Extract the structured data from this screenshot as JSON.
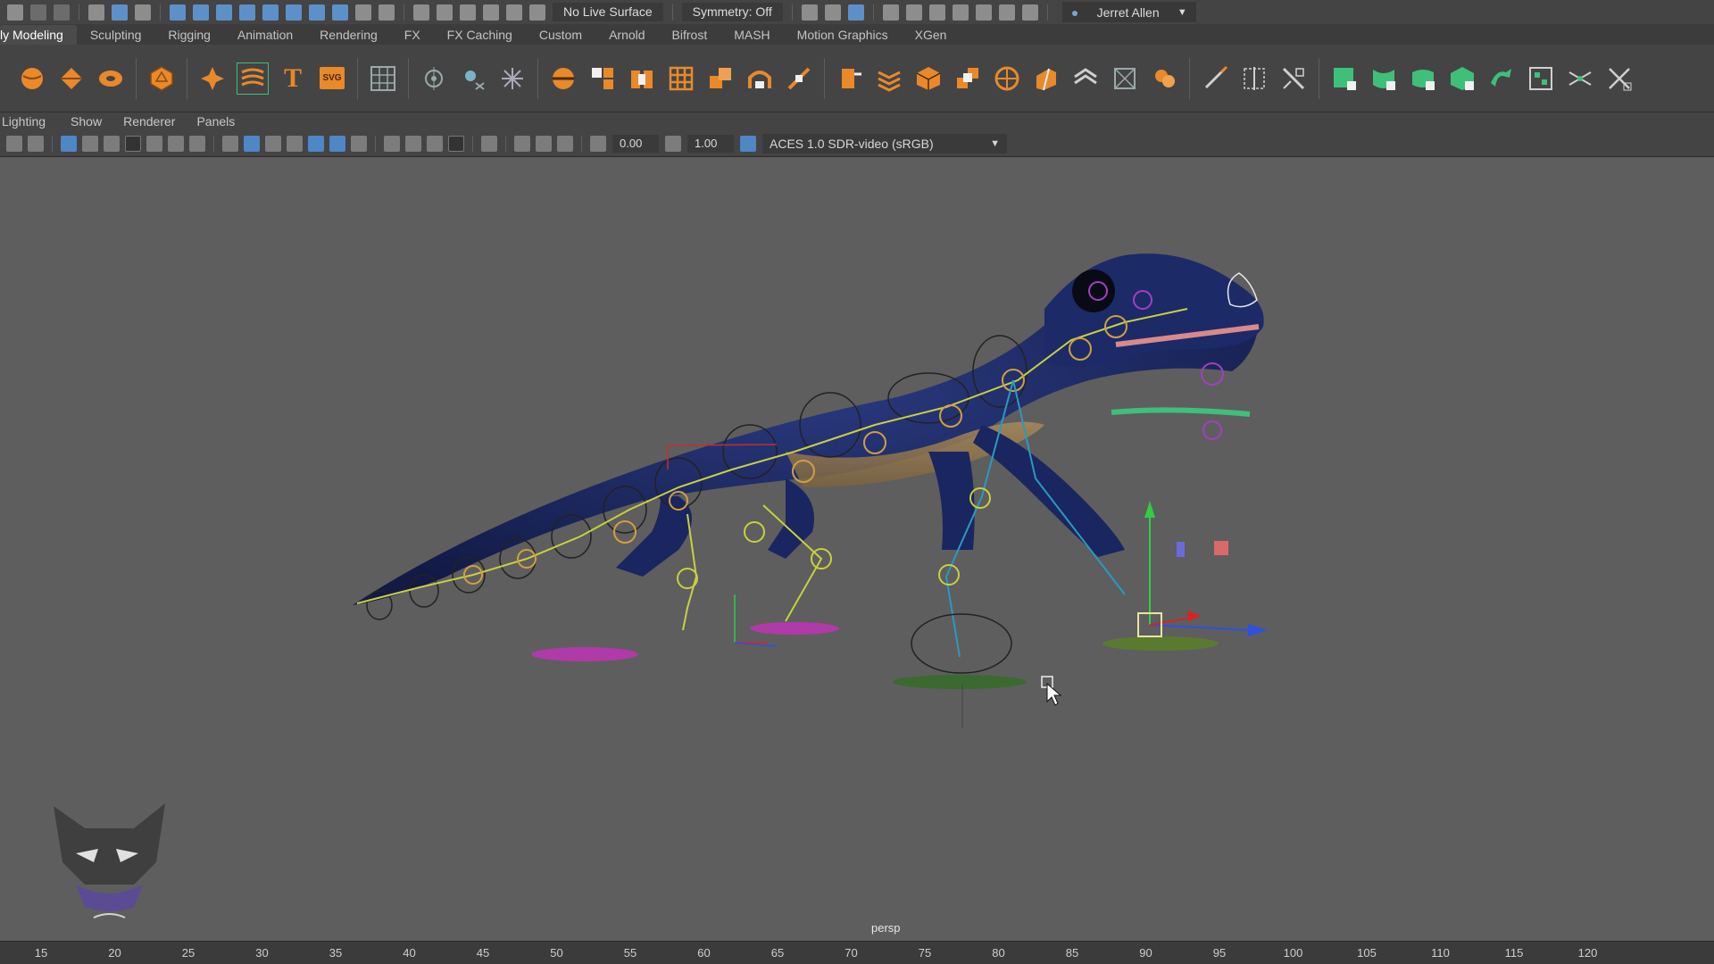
{
  "status_line": {
    "live_surface": "No Live Surface",
    "symmetry": "Symmetry: Off",
    "user_name": "Jerret Allen"
  },
  "shelf_tabs": [
    {
      "label": "ly Modeling",
      "active": true
    },
    {
      "label": "Sculpting"
    },
    {
      "label": "Rigging"
    },
    {
      "label": "Animation"
    },
    {
      "label": "Rendering"
    },
    {
      "label": "FX"
    },
    {
      "label": "FX Caching"
    },
    {
      "label": "Custom"
    },
    {
      "label": "Arnold"
    },
    {
      "label": "Bifrost"
    },
    {
      "label": "MASH"
    },
    {
      "label": "Motion Graphics"
    },
    {
      "label": "XGen"
    }
  ],
  "shelf_icons": {
    "text_tool_glyph": "T",
    "svg_tool_label": "SVG"
  },
  "panel_menu": [
    "Lighting",
    "Show",
    "Renderer",
    "Panels"
  ],
  "panel_toolbar": {
    "exposure": "0.00",
    "gamma": "1.00",
    "color_management": "ACES 1.0 SDR-video (sRGB)"
  },
  "viewport": {
    "camera_label": "persp"
  },
  "timeline": {
    "ticks": [
      "15",
      "20",
      "25",
      "30",
      "35",
      "40",
      "45",
      "50",
      "55",
      "60",
      "65",
      "70",
      "75",
      "80",
      "85",
      "90",
      "95",
      "100",
      "105",
      "110",
      "115",
      "120"
    ]
  },
  "colors": {
    "accent_orange": "#e8892a",
    "accent_green": "#3fbf7a",
    "accent_blue": "#5d90c8"
  }
}
